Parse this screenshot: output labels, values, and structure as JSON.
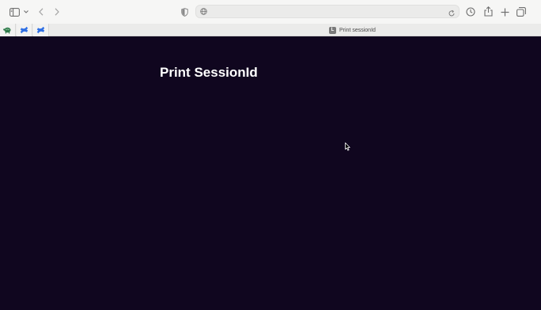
{
  "browser": {
    "address_value": "",
    "address_placeholder": "",
    "pinned_tabs": [
      {
        "icon": "turtle-favicon-icon"
      },
      {
        "icon": "confluence-favicon-icon"
      },
      {
        "icon": "confluence-favicon-icon"
      }
    ],
    "active_tab": {
      "title": "Print sessionId",
      "icon_letter": "L"
    }
  },
  "page": {
    "title": "Print SessionId",
    "background_color": "#10061f"
  },
  "colors": {
    "toolbar_bg": "#f6f6f5",
    "accent_blue": "#2f6fe4",
    "favicon_green": "#2f7a4a"
  }
}
